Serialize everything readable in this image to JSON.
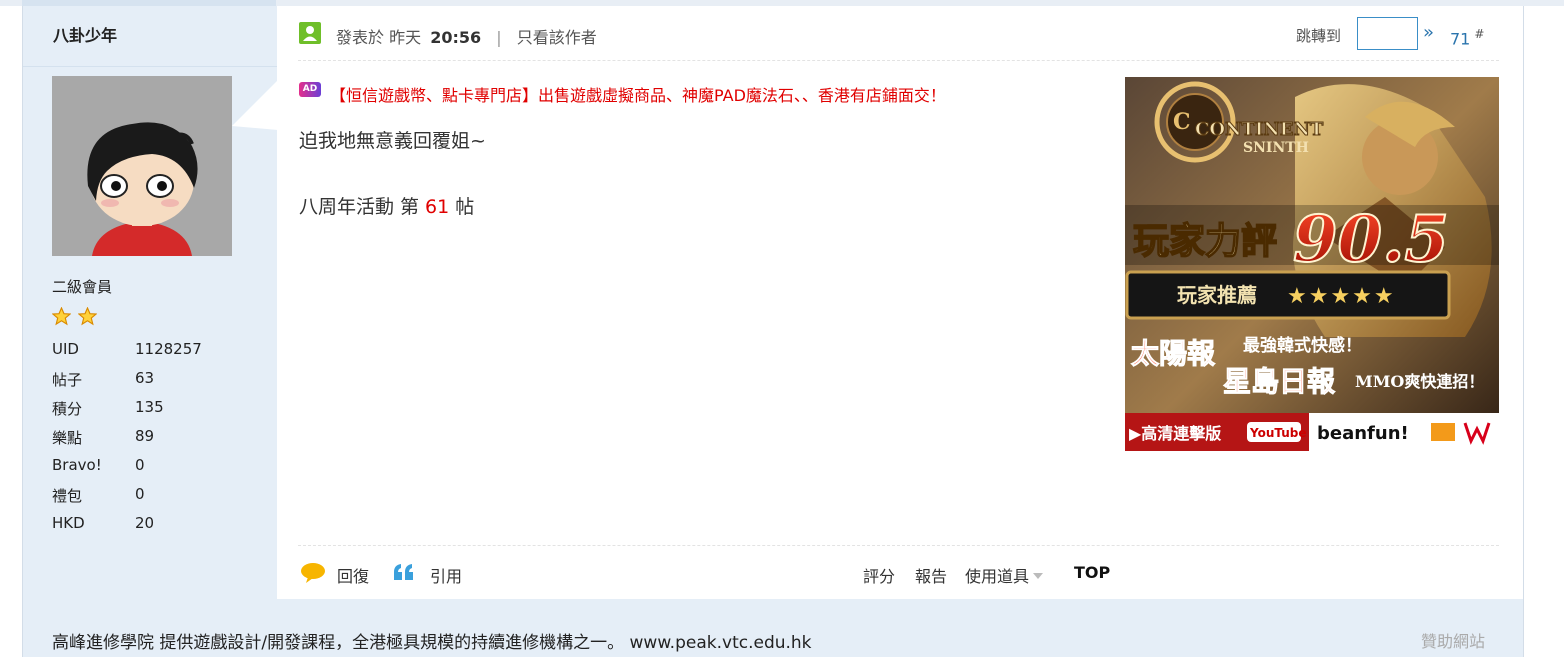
{
  "user": {
    "name": "八卦少年",
    "grade": "二級會員",
    "stats": [
      {
        "label": "UID",
        "value": "1128257"
      },
      {
        "label": "帖子",
        "value": "63"
      },
      {
        "label": "積分",
        "value": "135"
      },
      {
        "label": "樂點",
        "value": "89"
      },
      {
        "label": "Bravo!",
        "value": "0"
      },
      {
        "label": "禮包",
        "value": "0"
      },
      {
        "label": "HKD",
        "value": "20"
      }
    ]
  },
  "post": {
    "posted_prefix": "發表於",
    "posted_day": "昨天",
    "posted_time": "20:56",
    "separator": "|",
    "only_author": "只看該作者",
    "jump_label": "跳轉到",
    "jump_go": "»",
    "floor": "71",
    "floor_mark": "#",
    "ad_badge": "AD",
    "ad_text": "【恒信遊戲幣、點卡專門店】出售遊戲虛擬商品、神魔PAD魔法石、、香港有店鋪面交！",
    "message": "迫我地無意義回覆姐~",
    "event_prefix": "八周年活動 第",
    "event_number": "61",
    "event_suffix": "帖"
  },
  "banner": {
    "logo_line1": "CONTINENT",
    "logo_line2": "SNINTH",
    "rating_label": "玩家力評",
    "rating_value": "90.5",
    "recommend": "玩家推薦",
    "recommend_stars": "★★★★★",
    "quote1_source": "太陽報",
    "quote1_text": "最強韓式快感！",
    "quote2_source": "星島日報",
    "quote2_text": "MMO爽快連招！",
    "video_label": "▶高清連擊版",
    "youtube": "YouTube",
    "brand": "beanfun!"
  },
  "actions": {
    "reply": "回復",
    "quote": "引用",
    "rate": "評分",
    "report": "報告",
    "tools": "使用道具",
    "top": "TOP"
  },
  "footer": {
    "sponsor_text": "高峰進修學院 提供遊戲設計/開發課程，全港極具規模的持續進修機構之一。 www.peak.vtc.edu.hk",
    "sponsor_site": "贊助網站"
  },
  "colors": {
    "sidebar_bg": "#e5eef7",
    "link_blue": "#2a74ad",
    "ad_red": "#e00000",
    "online_green": "#6fbf29"
  }
}
